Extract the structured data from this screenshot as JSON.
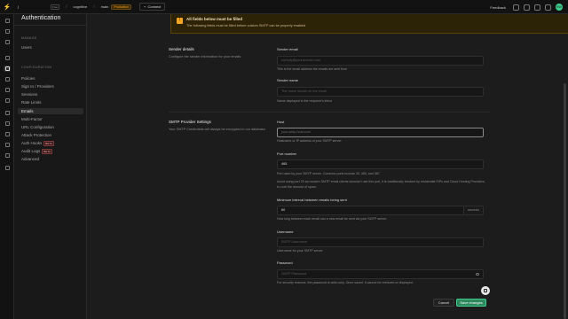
{
  "topbar": {
    "org": "j",
    "org_badge": "Free",
    "project": "cognitive",
    "branch": "main",
    "env_badge": "Production",
    "connect_label": "Connect",
    "feedback_label": "Feedback",
    "avatar_initials": "KW"
  },
  "sidebar": {
    "title": "Authentication",
    "manage_heading": "MANAGE",
    "manage_items": [
      "Users"
    ],
    "config_heading": "CONFIGURATION",
    "items": [
      {
        "label": "Policies"
      },
      {
        "label": "Sign In / Providers"
      },
      {
        "label": "Sessions"
      },
      {
        "label": "Rate Limits"
      },
      {
        "label": "Emails",
        "active": true
      },
      {
        "label": "Multi-Factor"
      },
      {
        "label": "URL Configuration"
      },
      {
        "label": "Attack Protection"
      },
      {
        "label": "Auth Hooks",
        "badge": "BETA"
      },
      {
        "label": "Audit Logs",
        "badge": "BETA"
      },
      {
        "label": "Advanced"
      }
    ]
  },
  "warning": {
    "title": "All fields below must be filled",
    "text": "The following fields must be filled before custom SMTP can be properly enabled"
  },
  "sender": {
    "title": "Sender details",
    "desc": "Configure the sender information for your emails",
    "email_label": "Sender email",
    "email_placeholder": "noreply@yourdomain.com",
    "email_help": "This is the email address the emails are sent from",
    "name_label": "Sender name",
    "name_placeholder": "The name shown on the email",
    "name_help": "Name displayed in the recipient's inbox"
  },
  "smtp": {
    "title": "SMTP Provider Settings",
    "desc": "Your SMTP Credentials will always be encrypted in our database.",
    "host_label": "Host",
    "host_placeholder": "your.smtp.host.com",
    "host_help": "Hostname or IP address of your SMTP server.",
    "port_label": "Port number",
    "port_value": "465",
    "port_help": "Port used by your SMTP server. Common ports include 25, 465, and 587.",
    "port_help2": "Avoid using port 25 as modern SMTP email clients shouldn't use this port, it is traditionally blocked by residential ISPs and Cloud Hosting Providers, to curb the amount of spam.",
    "interval_label": "Minimum interval between emails being sent",
    "interval_value": "60",
    "interval_suffix": "seconds",
    "interval_help": "How long between each email can a new email be sent via your SMTP server.",
    "user_label": "Username",
    "user_placeholder": "SMTP Username",
    "user_help": "Username for your SMTP server",
    "pass_label": "Password",
    "pass_placeholder": "SMTP Password",
    "pass_help": "For security reasons, the password is write-only. Once saved, it cannot be retrieved or displayed."
  },
  "actions": {
    "cancel_label": "Cancel",
    "save_label": "Save changes"
  },
  "colors": {
    "accent": "#3ecf8e",
    "warning": "#f5a623"
  }
}
